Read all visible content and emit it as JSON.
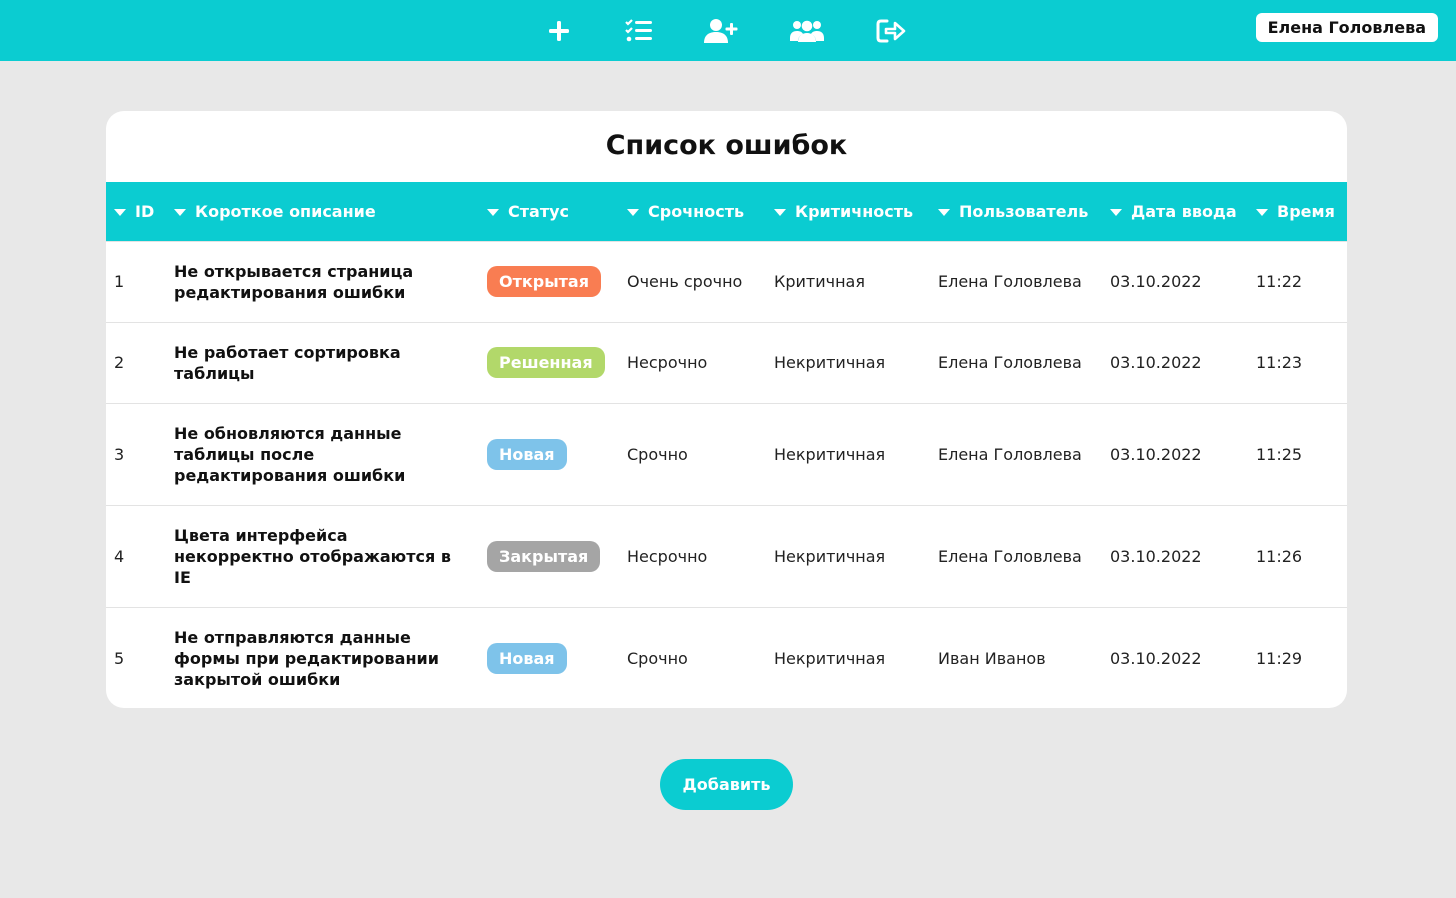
{
  "header": {
    "user_name": "Елена Головлева",
    "nav": [
      {
        "name": "add-icon"
      },
      {
        "name": "task-list-icon"
      },
      {
        "name": "add-user-icon"
      },
      {
        "name": "users-icon"
      },
      {
        "name": "logout-icon"
      }
    ],
    "accent_color": "#0bccd1"
  },
  "main": {
    "title": "Список ошибок",
    "columns": [
      "ID",
      "Короткое описание",
      "Статус",
      "Срочность",
      "Критичность",
      "Пользователь",
      "Дата ввода",
      "Время"
    ],
    "rows": [
      {
        "id": "1",
        "desc": "Не открывается страница редактирования ошибки",
        "status": "Открытая",
        "status_color": "#f97d52",
        "urgency": "Очень срочно",
        "criticality": "Критичная",
        "user": "Елена Головлева",
        "date": "03.10.2022",
        "time": "11:22"
      },
      {
        "id": "2",
        "desc": "Не работает сортировка таблицы",
        "status": "Решенная",
        "status_color": "#b2d86a",
        "urgency": "Несрочно",
        "criticality": "Некритичная",
        "user": "Елена Головлева",
        "date": "03.10.2022",
        "time": "11:23"
      },
      {
        "id": "3",
        "desc": "Не обновляются данные таблицы после редактирования ошибки",
        "status": "Новая",
        "status_color": "#7ec3ea",
        "urgency": "Срочно",
        "criticality": "Некритичная",
        "user": "Елена Головлева",
        "date": "03.10.2022",
        "time": "11:25"
      },
      {
        "id": "4",
        "desc": "Цвета интерфейса некорректно отображаются в IE",
        "status": "Закрытая",
        "status_color": "#a5a5a5",
        "urgency": "Несрочно",
        "criticality": "Некритичная",
        "user": "Елена Головлева",
        "date": "03.10.2022",
        "time": "11:26"
      },
      {
        "id": "5",
        "desc": "Не отправляются данные формы при редактировании закрытой ошибки",
        "status": "Новая",
        "status_color": "#7ec3ea",
        "urgency": "Срочно",
        "criticality": "Некритичная",
        "user": "Иван Иванов",
        "date": "03.10.2022",
        "time": "11:29"
      }
    ],
    "add_label": "Добавить"
  }
}
